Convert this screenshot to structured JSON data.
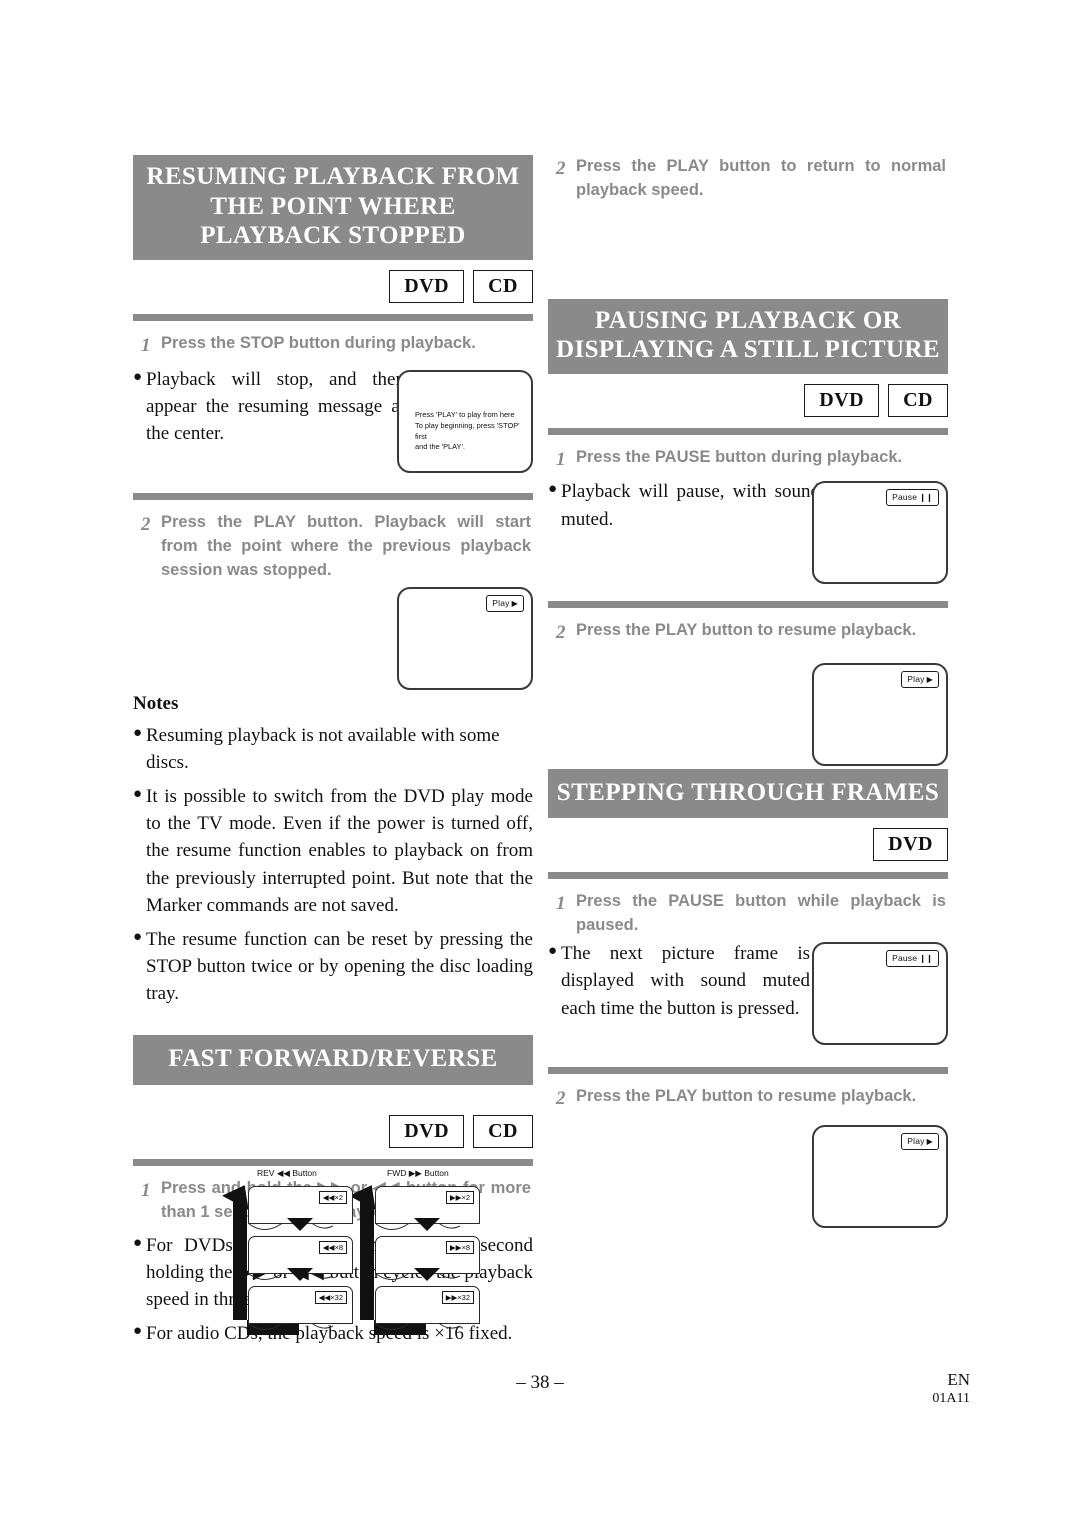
{
  "colors": {
    "band_gray": "#8a8a8a",
    "step_text_gray": "#8a8a8a",
    "body_black": "#111111"
  },
  "left_column": {
    "section1": {
      "title_line1": "RESUMING PLAYBACK FROM",
      "title_line2": "THE POINT WHERE",
      "title_line3": "PLAYBACK STOPPED",
      "badges": [
        "DVD",
        "CD"
      ],
      "step1": {
        "num": "1",
        "text": "Press the STOP button during playback."
      },
      "bullet1": "Playback will stop, and then appear the resuming message at the center.",
      "tv1_message_line1": "Press 'PLAY' to play from here",
      "tv1_message_line2": "To play beginning, press 'STOP' first",
      "tv1_message_line3": "and the 'PLAY'.",
      "step2": {
        "num": "2",
        "text": "Press the PLAY button. Playback will start from the point where the previous playback session was stopped."
      },
      "tv2_badge": "Play",
      "tv2_badge_glyph": "▶"
    },
    "notes": {
      "heading": "Notes",
      "items": [
        "Resuming playback is not available with some discs.",
        "It is possible to switch from the DVD play mode to the TV mode. Even if the power is turned off, the resume function enables to playback on from the previously interrupted point. But note that the Marker commands are not saved.",
        "The resume function can be reset by pressing the STOP button twice or by opening the disc loading tray."
      ]
    },
    "section2": {
      "title_line1": "FAST FORWARD/REVERSE",
      "badges": [
        "DVD",
        "CD"
      ],
      "step1": {
        "num": "1",
        "text_part1": "Press and hold the",
        "glyph_fwd": "▶▶",
        "text_part2": "or",
        "glyph_rev": "◀◀",
        "text_part3": "button for more than 1 second during playback."
      },
      "bullet1_part1": "For DVDs, pressing and more than 1 second holding the",
      "bullet1_glyph_fwd": "▶▶",
      "bullet1_part2": "or",
      "bullet1_glyph_rev": "◀◀",
      "bullet1_part3": "button cycles the playback speed in three steps.",
      "bullet2": "For audio CDs, the playback speed is ×16 fixed."
    }
  },
  "right_column": {
    "step_ff2": {
      "num": "2",
      "text": "Press the PLAY button to return to normal playback speed."
    },
    "section3": {
      "title_line1": "PAUSING PLAYBACK OR",
      "title_line2": "DISPLAYING A STILL PICTURE",
      "badges": [
        "DVD",
        "CD"
      ],
      "step1": {
        "num": "1",
        "text": "Press the PAUSE button during playback."
      },
      "bullet1": "Playback will pause, with sound muted.",
      "tv1_badge": "Pause",
      "tv1_badge_glyph": "❙❙",
      "step2": {
        "num": "2",
        "text": "Press the PLAY button to resume playback."
      },
      "tv2_badge": "Play",
      "tv2_badge_glyph": "▶"
    },
    "section4": {
      "title_line1": "STEPPING THROUGH FRAMES",
      "badges": [
        "DVD"
      ],
      "step1": {
        "num": "1",
        "text": "Press the PAUSE button while playback is paused."
      },
      "bullet1": "The next picture frame is displayed with sound muted each time the button is pressed.",
      "tv1_badge": "Pause",
      "tv1_badge_glyph": "❙❙",
      "step2": {
        "num": "2",
        "text": "Press the PLAY button to resume playback."
      },
      "tv2_badge": "Play",
      "tv2_badge_glyph": "▶"
    }
  },
  "speed_diagram": {
    "rev_label_prefix": "REV",
    "rev_label_glyph": "◀◀",
    "rev_label_suffix": "Button",
    "fwd_label_prefix": "FWD",
    "fwd_label_glyph": "▶▶",
    "fwd_label_suffix": "Button",
    "rev_speeds": [
      "◀◀×2",
      "◀◀×8",
      "◀◀×32"
    ],
    "fwd_speeds": [
      "▶▶×2",
      "▶▶×8",
      "▶▶×32"
    ]
  },
  "footer": {
    "page_number": "– 38 –",
    "language": "EN",
    "doc_code": "01A11"
  }
}
